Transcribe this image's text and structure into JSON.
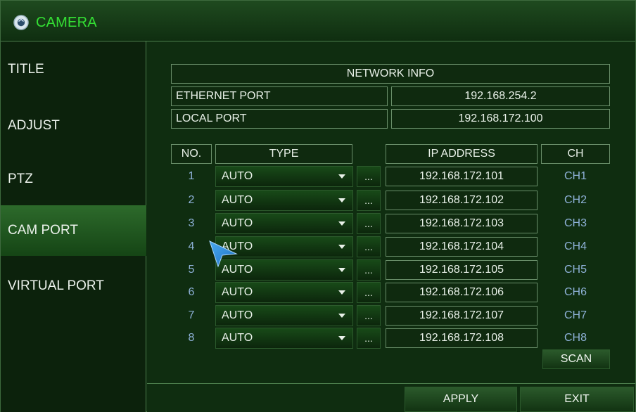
{
  "window": {
    "title": "CAMERA"
  },
  "sidebar": {
    "items": [
      {
        "label": "TITLE",
        "active": false
      },
      {
        "label": "ADJUST",
        "active": false
      },
      {
        "label": "PTZ",
        "active": false
      },
      {
        "label": "CAM PORT",
        "active": true
      },
      {
        "label": "VIRTUAL PORT",
        "active": false
      }
    ]
  },
  "network": {
    "header": "NETWORK INFO",
    "ethernet_label": "ETHERNET PORT",
    "ethernet_value": "192.168.254.2",
    "local_label": "LOCAL PORT",
    "local_value": "192.168.172.100"
  },
  "table": {
    "headers": {
      "no": "NO.",
      "type": "TYPE",
      "ip": "IP ADDRESS",
      "ch": "CH"
    },
    "rows": [
      {
        "no": "1",
        "type": "AUTO",
        "dots": "...",
        "ip": "192.168.172.101",
        "ch": "CH1"
      },
      {
        "no": "2",
        "type": "AUTO",
        "dots": "...",
        "ip": "192.168.172.102",
        "ch": "CH2"
      },
      {
        "no": "3",
        "type": "AUTO",
        "dots": "...",
        "ip": "192.168.172.103",
        "ch": "CH3"
      },
      {
        "no": "4",
        "type": "AUTO",
        "dots": "...",
        "ip": "192.168.172.104",
        "ch": "CH4"
      },
      {
        "no": "5",
        "type": "AUTO",
        "dots": "...",
        "ip": "192.168.172.105",
        "ch": "CH5"
      },
      {
        "no": "6",
        "type": "AUTO",
        "dots": "...",
        "ip": "192.168.172.106",
        "ch": "CH6"
      },
      {
        "no": "7",
        "type": "AUTO",
        "dots": "...",
        "ip": "192.168.172.107",
        "ch": "CH7"
      },
      {
        "no": "8",
        "type": "AUTO",
        "dots": "...",
        "ip": "192.168.172.108",
        "ch": "CH8"
      }
    ]
  },
  "buttons": {
    "scan": "SCAN",
    "apply": "APPLY",
    "exit": "EXIT"
  },
  "colors": {
    "accent_text": "#34e034",
    "channel_text": "#8fb2d9",
    "cursor": "#2f8fe0"
  },
  "icons": {
    "title": "camera-lens-icon",
    "cursor": "mouse-pointer-icon",
    "dropdown": "chevron-down-icon"
  }
}
